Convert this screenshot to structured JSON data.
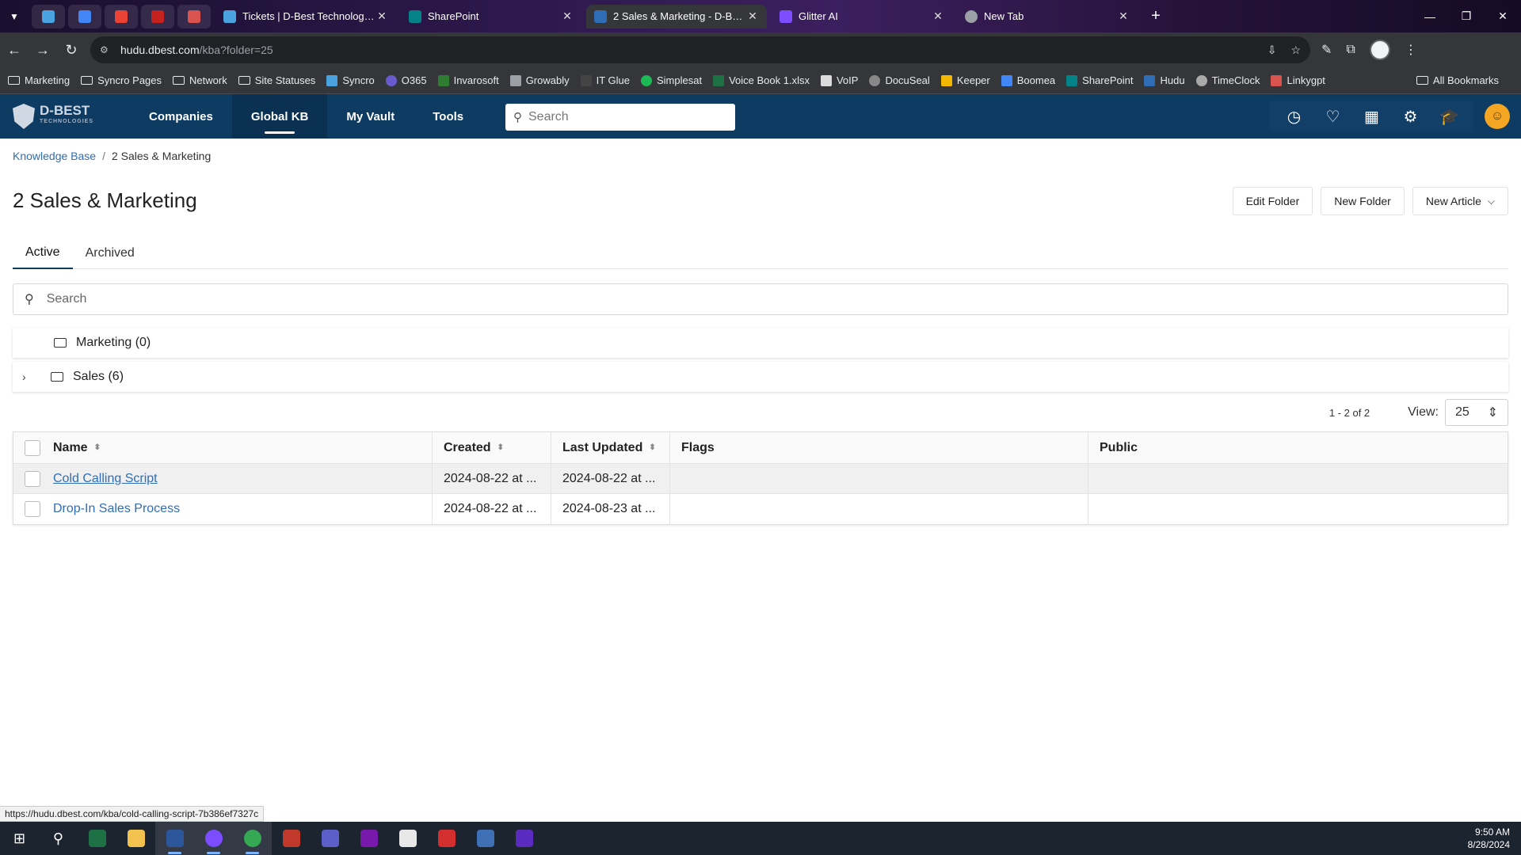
{
  "browser": {
    "tabs": [
      {
        "title": "Tickets | D-Best Technologies",
        "color": "#4aa3df"
      },
      {
        "title": "SharePoint",
        "color": "#038387"
      },
      {
        "title": "2 Sales & Marketing - D-Best Te",
        "color": "#2f6db5"
      },
      {
        "title": "Glitter AI",
        "color": "#7b4dff"
      },
      {
        "title": "New Tab",
        "color": "#9aa0a6"
      }
    ],
    "url_host": "hudu.dbest.com",
    "url_path": "/kba?folder=25",
    "bookmarks": [
      {
        "label": "Marketing",
        "type": "folder"
      },
      {
        "label": "Syncro Pages",
        "type": "folder"
      },
      {
        "label": "Network",
        "type": "folder"
      },
      {
        "label": "Site Statuses",
        "type": "folder"
      },
      {
        "label": "Syncro",
        "color": "#4aa3df"
      },
      {
        "label": "O365",
        "color": "#6a5acd"
      },
      {
        "label": "Invarosoft",
        "color": "#2e7d32"
      },
      {
        "label": "Growably",
        "color": "#9aa0a6"
      },
      {
        "label": "IT Glue",
        "color": "#444"
      },
      {
        "label": "Simplesat",
        "color": "#1db954"
      },
      {
        "label": "Voice Book 1.xlsx",
        "color": "#1e7145"
      },
      {
        "label": "VoIP",
        "color": "#dcdcdc"
      },
      {
        "label": "DocuSeal",
        "color": "#888"
      },
      {
        "label": "Keeper",
        "color": "#f5b800"
      },
      {
        "label": "Boomea",
        "color": "#4285f4"
      },
      {
        "label": "SharePoint",
        "color": "#038387"
      },
      {
        "label": "Hudu",
        "color": "#2f6db5"
      },
      {
        "label": "TimeClock",
        "color": "#aaa"
      },
      {
        "label": "Linkygpt",
        "color": "#d9534f"
      }
    ],
    "all_bookmarks": "All Bookmarks"
  },
  "app": {
    "logo_text": "D-BEST",
    "logo_sub": "TECHNOLOGIES",
    "nav": [
      "Companies",
      "Global KB",
      "My Vault",
      "Tools"
    ],
    "active_nav": "Global KB",
    "search_placeholder": "Search"
  },
  "page": {
    "breadcrumb_root": "Knowledge Base",
    "breadcrumb_sep": "/",
    "breadcrumb_current": "2 Sales & Marketing",
    "title": "2 Sales & Marketing",
    "buttons": {
      "edit_folder": "Edit Folder",
      "new_folder": "New Folder",
      "new_article": "New Article"
    },
    "tabs": {
      "active": "Active",
      "archived": "Archived"
    },
    "filter_placeholder": "Search",
    "folders": [
      {
        "label": "Marketing (0)",
        "expandable": false
      },
      {
        "label": "Sales (6)",
        "expandable": true
      }
    ],
    "pagination": {
      "count": "1 - 2 of 2",
      "view_label": "View:",
      "view_value": "25"
    },
    "table": {
      "headers": {
        "name": "Name",
        "created": "Created",
        "updated": "Last Updated",
        "flags": "Flags",
        "public": "Public"
      },
      "rows": [
        {
          "name": "Cold Calling Script",
          "created": "2024-08-22 at ...",
          "updated": "2024-08-22 at ...",
          "flags": "",
          "public": ""
        },
        {
          "name": "Drop-In Sales Process",
          "created": "2024-08-22 at ...",
          "updated": "2024-08-23 at ...",
          "flags": "",
          "public": ""
        }
      ]
    }
  },
  "status_url": "https://hudu.dbest.com/kba/cold-calling-script-7b386ef7327c",
  "taskbar": {
    "time": "9:50 AM",
    "date": "8/28/2024"
  }
}
